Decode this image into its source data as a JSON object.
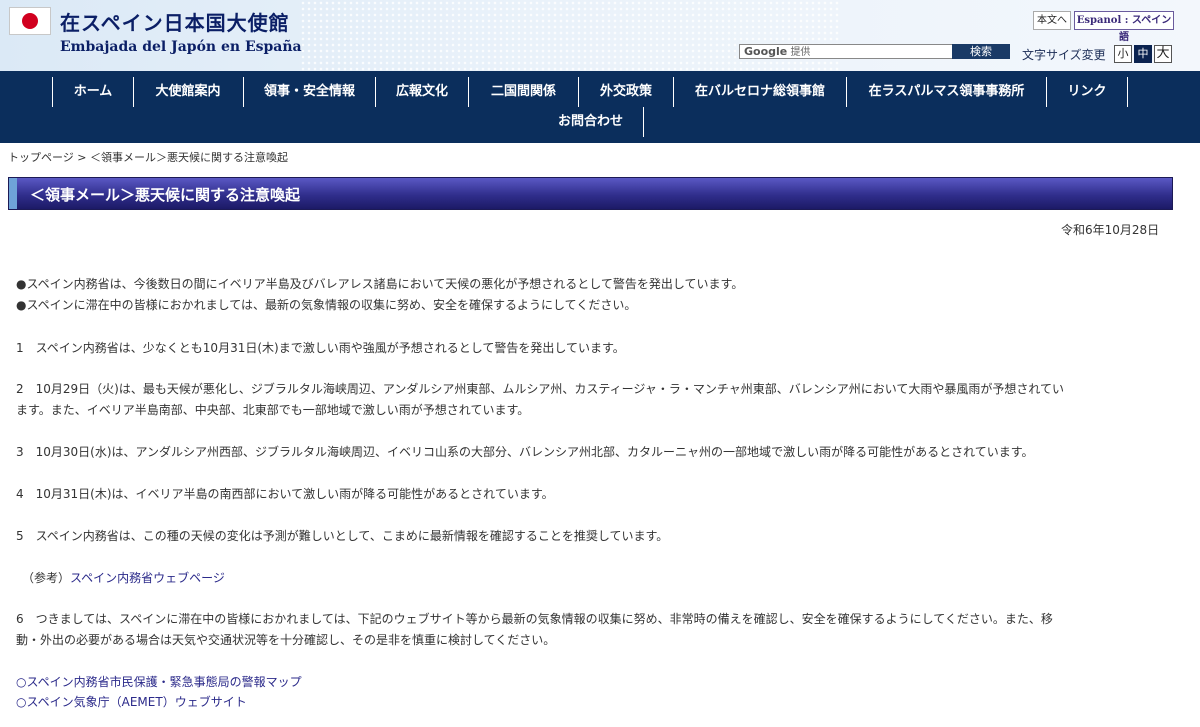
{
  "header": {
    "title_ja": "在スペイン日本国大使館",
    "title_es": "Embajada del Japón en España",
    "honbun_label": "本文へ",
    "espanol_label": "Espanol : スペイン語",
    "search": {
      "google_label": "Google",
      "provided_label": "提供",
      "button_label": "検索"
    },
    "font_size": {
      "label": "文字サイズ変更",
      "small": "小",
      "medium": "中",
      "large": "大"
    }
  },
  "nav": {
    "items": [
      "ホーム",
      "大使館案内",
      "領事・安全情報",
      "広報文化",
      "二国間関係",
      "外交政策",
      "在バルセロナ総領事館",
      "在ラスパルマス領事事務所",
      "リンク",
      "お問合わせ"
    ]
  },
  "breadcrumb": "トップページ > ＜領事メール＞悪天候に関する注意喚起",
  "page": {
    "title": "＜領事メール＞悪天候に関する注意喚起",
    "date": "令和6年10月28日",
    "lines": [
      "●スペイン内務省は、今後数日の間にイベリア半島及びバレアレス諸島において天候の悪化が予想されるとして警告を発出しています。",
      "●スペインに滞在中の皆様におかれましては、最新の気象情報の収集に努め、安全を確保するようにしてください。",
      "1　スペイン内務省は、少なくとも10月31日(木)まで激しい雨や強風が予想されるとして警告を発出しています。",
      "2　10月29日（火)は、最も天候が悪化し、ジブラルタル海峡周辺、アンダルシア州東部、ムルシア州、カスティージャ・ラ・マンチャ州東部、バレンシア州において大雨や暴風雨が予想されてい",
      "ます。また、イベリア半島南部、中央部、北東部でも一部地域で激しい雨が予想されています。",
      "3　10月30日(水)は、アンダルシア州西部、ジブラルタル海峡周辺、イベリコ山系の大部分、バレンシア州北部、カタルーニャ州の一部地域で激しい雨が降る可能性があるとされています。",
      "4　10月31日(木)は、イベリア半島の南西部において激しい雨が降る可能性があるとされています。",
      "5　スペイン内務省は、この種の天候の変化は予測が難しいとして、こまめに最新情報を確認することを推奨しています。",
      "6　つきましては、スペインに滞在中の皆様におかれましては、下記のウェブサイト等から最新の気象情報の収集に努め、非常時の備えを確認し、安全を確保するようにしてください。また、移",
      "動・外出の必要がある場合は天気や交通状況等を十分確認し、その是非を慎重に検討してください。"
    ],
    "reference_prefix": "（参考）",
    "reference_link": "スペイン内務省ウェブページ",
    "links": [
      "○スペイン内務省市民保護・緊急事態局の警報マップ",
      "○スペイン気象庁（AEMET）ウェブサイト"
    ]
  }
}
